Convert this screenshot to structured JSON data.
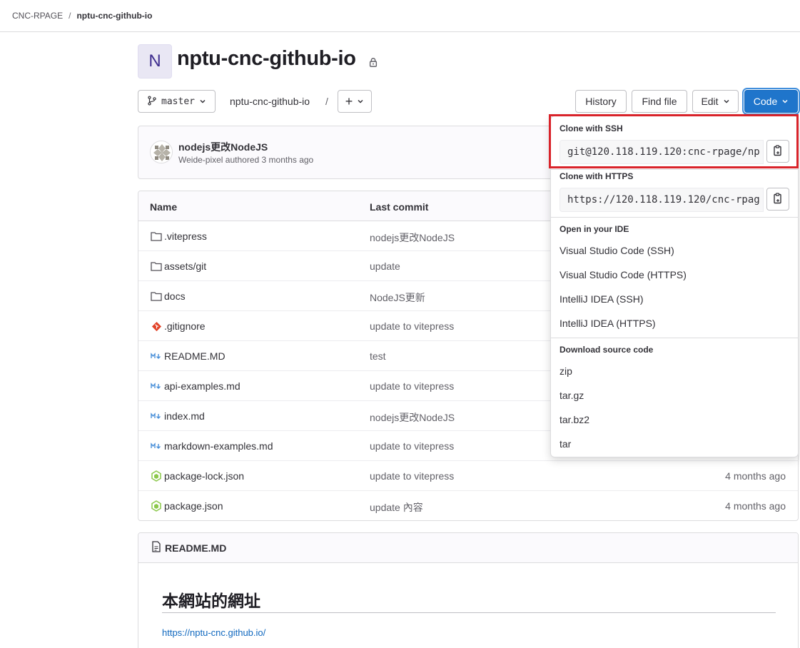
{
  "breadcrumb": {
    "group": "CNC-RPAGE",
    "separator": "/",
    "project": "nptu-cnc-github-io"
  },
  "project": {
    "avatar_letter": "N",
    "title": "nptu-cnc-github-io"
  },
  "toolbar": {
    "branch": "master",
    "path": "nptu-cnc-github-io",
    "path_sep": "/",
    "add_label": "+",
    "history_label": "History",
    "find_file_label": "Find file",
    "edit_label": "Edit",
    "code_label": "Code"
  },
  "commit": {
    "message": "nodejs更改NodeJS",
    "author_line": "Weide-pixel authored 3 months ago"
  },
  "files": {
    "headers": {
      "name": "Name",
      "last_commit": "Last commit"
    },
    "rows": [
      {
        "icon": "folder-icon",
        "name": ".vitepress",
        "last_commit": "nodejs更改NodeJS",
        "time": ""
      },
      {
        "icon": "folder-icon",
        "name": "assets/git",
        "last_commit": "update",
        "time": ""
      },
      {
        "icon": "folder-icon",
        "name": "docs",
        "last_commit": "NodeJS更新",
        "time": ""
      },
      {
        "icon": "git-icon",
        "name": ".gitignore",
        "last_commit": "update to vitepress",
        "time": ""
      },
      {
        "icon": "markdown-icon",
        "name": "README.MD",
        "last_commit": "test",
        "time": ""
      },
      {
        "icon": "markdown-icon",
        "name": "api-examples.md",
        "last_commit": "update to vitepress",
        "time": ""
      },
      {
        "icon": "markdown-icon",
        "name": "index.md",
        "last_commit": "nodejs更改NodeJS",
        "time": ""
      },
      {
        "icon": "markdown-icon",
        "name": "markdown-examples.md",
        "last_commit": "update to vitepress",
        "time": ""
      },
      {
        "icon": "nodejs-icon",
        "name": "package-lock.json",
        "last_commit": "update to vitepress",
        "time": "4 months ago"
      },
      {
        "icon": "nodejs-icon",
        "name": "package.json",
        "last_commit": "update 內容",
        "time": "4 months ago"
      }
    ]
  },
  "readme": {
    "filename": "README.MD",
    "heading": "本網站的網址",
    "link": "https://nptu-cnc.github.io/"
  },
  "code_dropdown": {
    "ssh_title": "Clone with SSH",
    "ssh_url": "git@120.118.119.120:cnc-rpage/np",
    "https_title": "Clone with HTTPS",
    "https_url": "https://120.118.119.120/cnc-rpag",
    "ide_title": "Open in your IDE",
    "ide_items": [
      "Visual Studio Code (SSH)",
      "Visual Studio Code (HTTPS)",
      "IntelliJ IDEA (SSH)",
      "IntelliJ IDEA (HTTPS)"
    ],
    "download_title": "Download source code",
    "download_items": [
      "zip",
      "tar.gz",
      "tar.bz2",
      "tar"
    ]
  },
  "colors": {
    "primary": "#1f75cb",
    "highlight": "#d9232a",
    "link": "#1068bf"
  }
}
